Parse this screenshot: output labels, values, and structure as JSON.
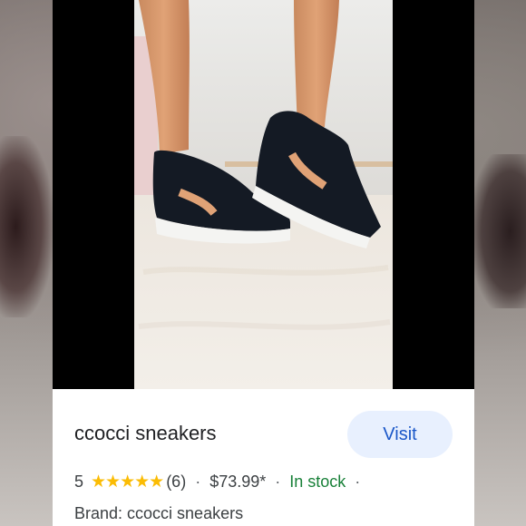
{
  "product": {
    "title": "ccocci sneakers",
    "visit_label": "Visit",
    "rating_value": "5",
    "stars": "★★★★★",
    "review_count": "(6)",
    "separator": "·",
    "price": "$73.99*",
    "stock_status": "In stock",
    "brand_line": "Brand: ccocci sneakers"
  },
  "colors": {
    "visit_bg": "#e8f0fe",
    "visit_text": "#1a57c8",
    "star": "#fbbc04",
    "in_stock": "#188038"
  },
  "image": {
    "subject": "black suede wedge sneakers with white soles worn on legs",
    "icon": "product-photo"
  }
}
